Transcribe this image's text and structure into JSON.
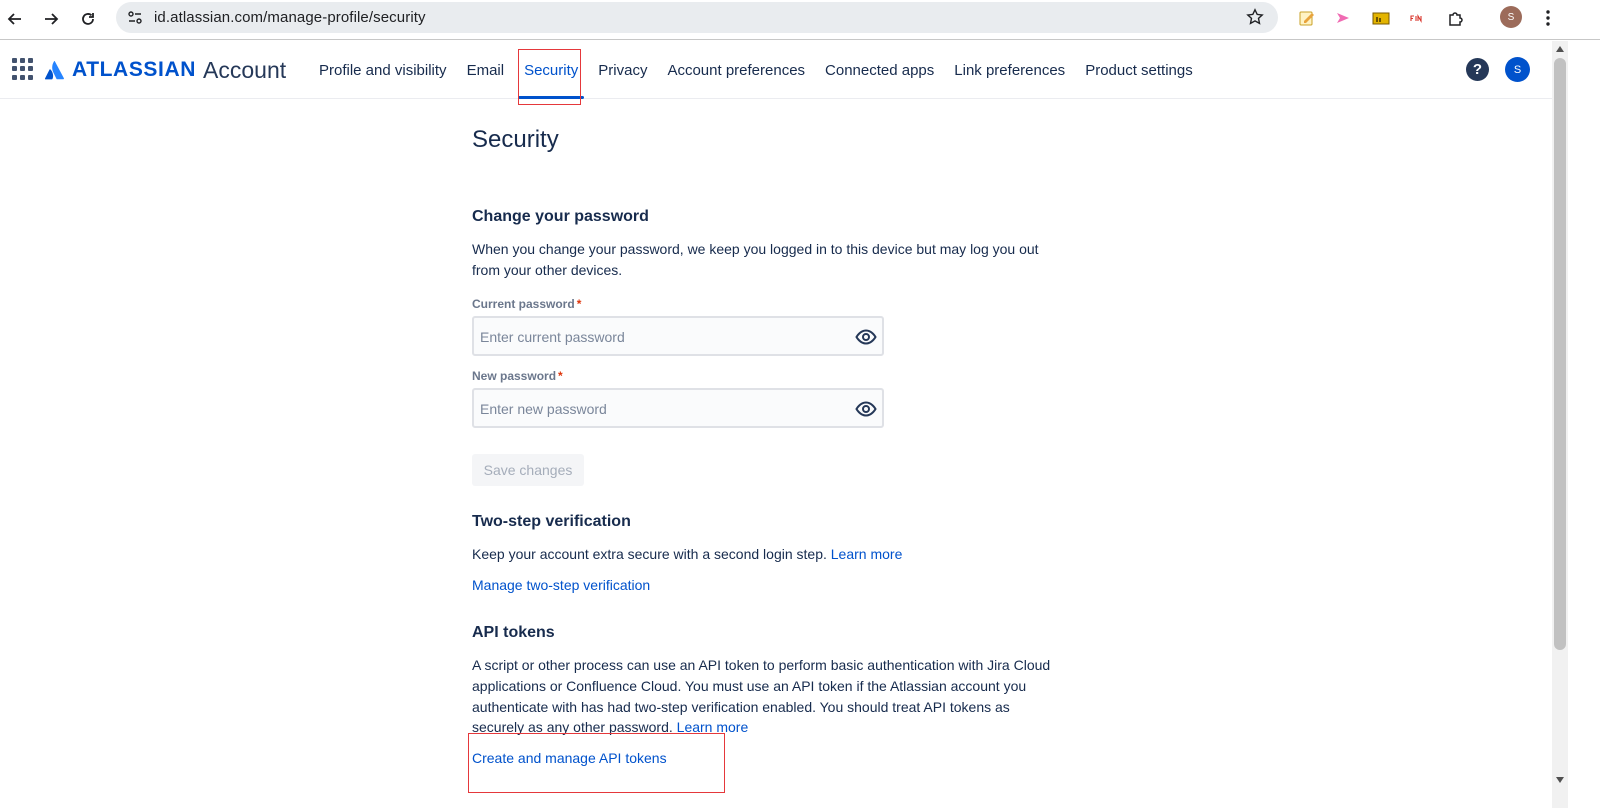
{
  "browser": {
    "url": "id.atlassian.com/manage-profile/security",
    "profile_initial": "S"
  },
  "header": {
    "brand": "ATLASSIAN",
    "product": "Account",
    "nav": [
      {
        "label": "Profile and visibility"
      },
      {
        "label": "Email"
      },
      {
        "label": "Security",
        "active": true
      },
      {
        "label": "Privacy"
      },
      {
        "label": "Account preferences"
      },
      {
        "label": "Connected apps"
      },
      {
        "label": "Link preferences"
      },
      {
        "label": "Product settings"
      }
    ],
    "help_label": "?",
    "avatar_initial": "S"
  },
  "page": {
    "title": "Security",
    "change_password": {
      "title": "Change your password",
      "description_line1": "When you change your password, we keep you logged in to this device but may log you out",
      "description_line2": "from your other devices.",
      "current_label": "Current password",
      "current_placeholder": "Enter current password",
      "new_label": "New password",
      "new_placeholder": "Enter new password",
      "required_mark": "*",
      "save_label": "Save changes"
    },
    "two_step": {
      "title": "Two-step verification",
      "description": "Keep your account extra secure with a second login step.",
      "learn_more": "Learn more",
      "manage_link": "Manage two-step verification"
    },
    "api_tokens": {
      "title": "API tokens",
      "line1": "A script or other process can use an API token to perform basic authentication with Jira Cloud",
      "line2": "applications or Confluence Cloud. You must use an API token if the Atlassian account you",
      "line3": "authenticate with has had two-step verification enabled. You should treat API tokens as",
      "line4": "securely as any other password.",
      "learn_more": "Learn more",
      "manage_link": "Create and manage API tokens"
    }
  },
  "colors": {
    "brand_blue": "#0052cc",
    "text": "#172b4d",
    "highlight": "#e5383b"
  }
}
